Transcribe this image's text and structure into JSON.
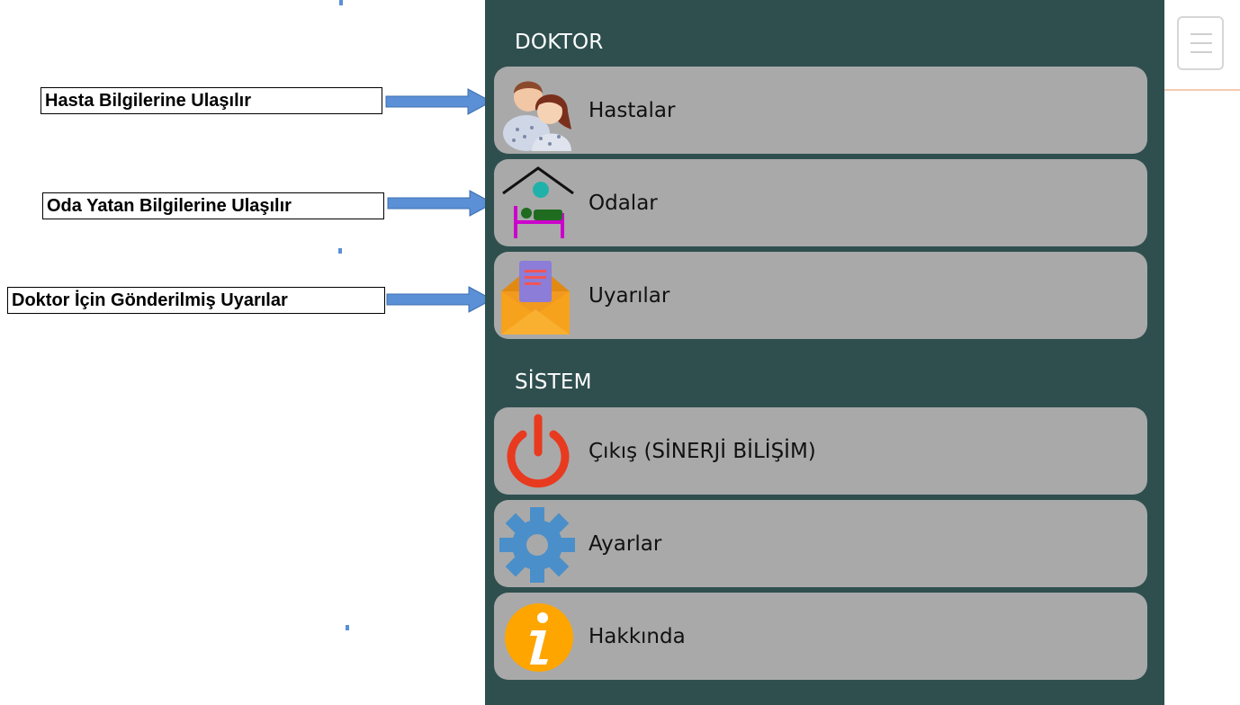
{
  "annotations": [
    {
      "text": "Hasta Bilgilerine Ulaşılır"
    },
    {
      "text": "Oda Yatan Bilgilerine Ulaşılır"
    },
    {
      "text": "Doktor İçin Gönderilmiş Uyarılar"
    }
  ],
  "drawer": {
    "sections": [
      {
        "title": "DOKTOR",
        "items": [
          {
            "label": "Hastalar",
            "icon": "patients-icon"
          },
          {
            "label": "Odalar",
            "icon": "hospital-bed-icon"
          },
          {
            "label": "Uyarılar",
            "icon": "mail-alert-icon"
          }
        ]
      },
      {
        "title": "SİSTEM",
        "items": [
          {
            "label": "Çıkış (SİNERJİ BİLİŞİM)",
            "icon": "power-icon"
          },
          {
            "label": "Ayarlar",
            "icon": "gear-icon"
          },
          {
            "label": "Hakkında",
            "icon": "info-icon"
          }
        ]
      }
    ]
  },
  "colors": {
    "drawer_bg": "#2f4f4f",
    "item_bg": "#a9a9a9",
    "arrow": "#5b8fd6",
    "power": "#e83a1f",
    "gear": "#4a8fc9",
    "info": "#ffa500"
  }
}
